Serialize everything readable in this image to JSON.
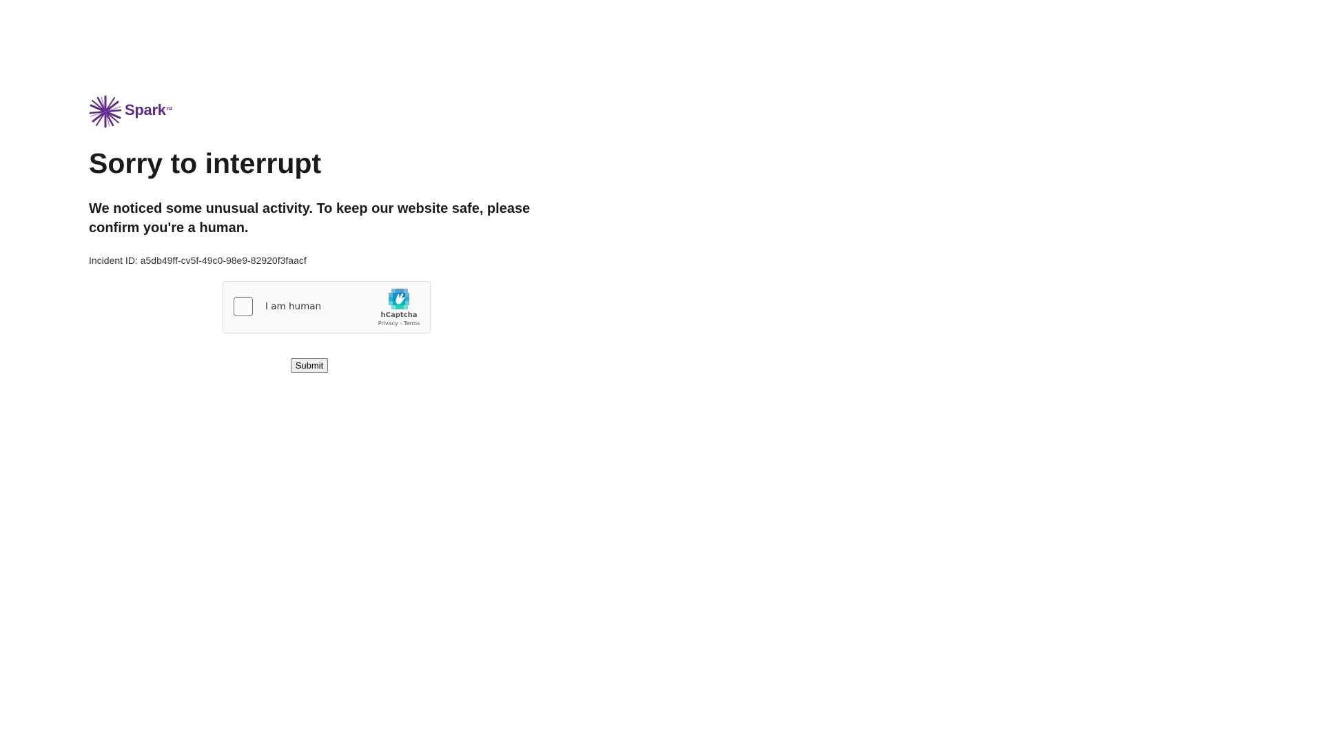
{
  "brand": {
    "name": "Spark",
    "superscript": "nz",
    "color": "#5e2a84"
  },
  "heading": "Sorry to interrupt",
  "message": "We noticed some unusual activity. To keep our website safe, please confirm you're a human.",
  "incident": {
    "label": "Incident ID:",
    "id": "a5db49ff-cv5f-49c0-98e9-82920f3faacf"
  },
  "captcha": {
    "checkbox_label": "I am human",
    "provider": "hCaptcha",
    "privacy_link": "Privacy",
    "separator": "-",
    "terms_link": "Terms",
    "checked": false
  },
  "form": {
    "submit_label": "Submit"
  }
}
